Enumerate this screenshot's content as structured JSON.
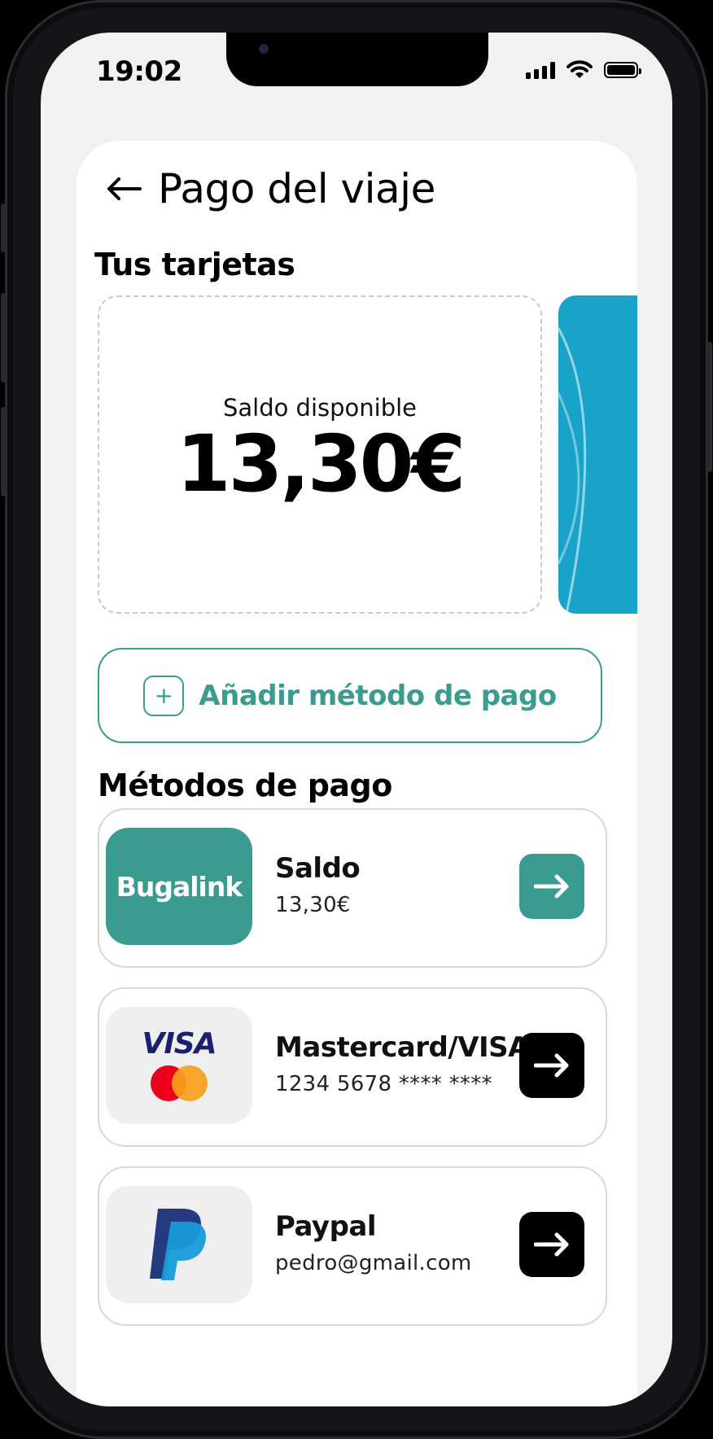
{
  "status_bar": {
    "time": "19:02"
  },
  "header": {
    "title": "Pago del viaje"
  },
  "cards_section": {
    "title": "Tus tarjetas",
    "balance_label": "Saldo disponible",
    "balance_amount": "13,30€"
  },
  "add_button": {
    "label": "Añadir método de pago",
    "icon": "plus-icon"
  },
  "methods_section": {
    "title": "Métodos de pago",
    "items": [
      {
        "logo_text": "Bugalink",
        "name": "Saldo",
        "detail": "13,30€",
        "accent": "#3a9b8f"
      },
      {
        "logo_text": "VISA",
        "name": "Mastercard/VISA",
        "detail": "1234 5678 **** ****",
        "accent": "#000000"
      },
      {
        "logo_text": "",
        "name": "Paypal",
        "detail": "pedro@gmail.com",
        "accent": "#000000"
      }
    ]
  },
  "colors": {
    "brand": "#3a9b8f",
    "peek_card": "#1aa3c8",
    "visa_blue": "#1a1f71",
    "mc_red": "#eb001b",
    "mc_orange": "#f79e1b"
  }
}
